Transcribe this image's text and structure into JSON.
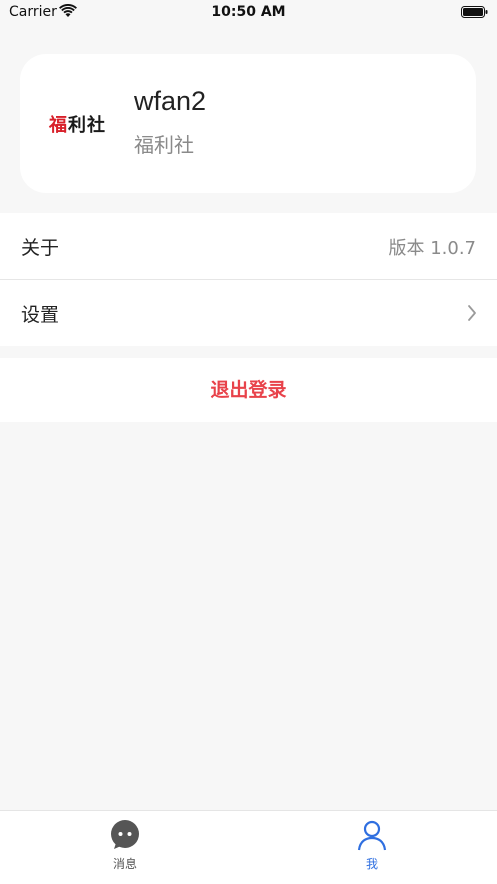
{
  "status_bar": {
    "carrier": "Carrier",
    "time": "10:50 AM"
  },
  "profile": {
    "logo_text_accent": "福",
    "logo_text_rest": "利社",
    "username": "wfan2",
    "org": "福利社"
  },
  "menu": {
    "about_label": "关于",
    "about_value": "版本 1.0.7",
    "settings_label": "设置"
  },
  "logout_label": "退出登录",
  "tabs": [
    {
      "label": "消息",
      "icon": "chat-bubble-icon"
    },
    {
      "label": "我",
      "icon": "person-icon",
      "active": true
    }
  ],
  "colors": {
    "accent": "#2f6fe0",
    "danger": "#e8424a",
    "logo_red": "#d8202a"
  }
}
